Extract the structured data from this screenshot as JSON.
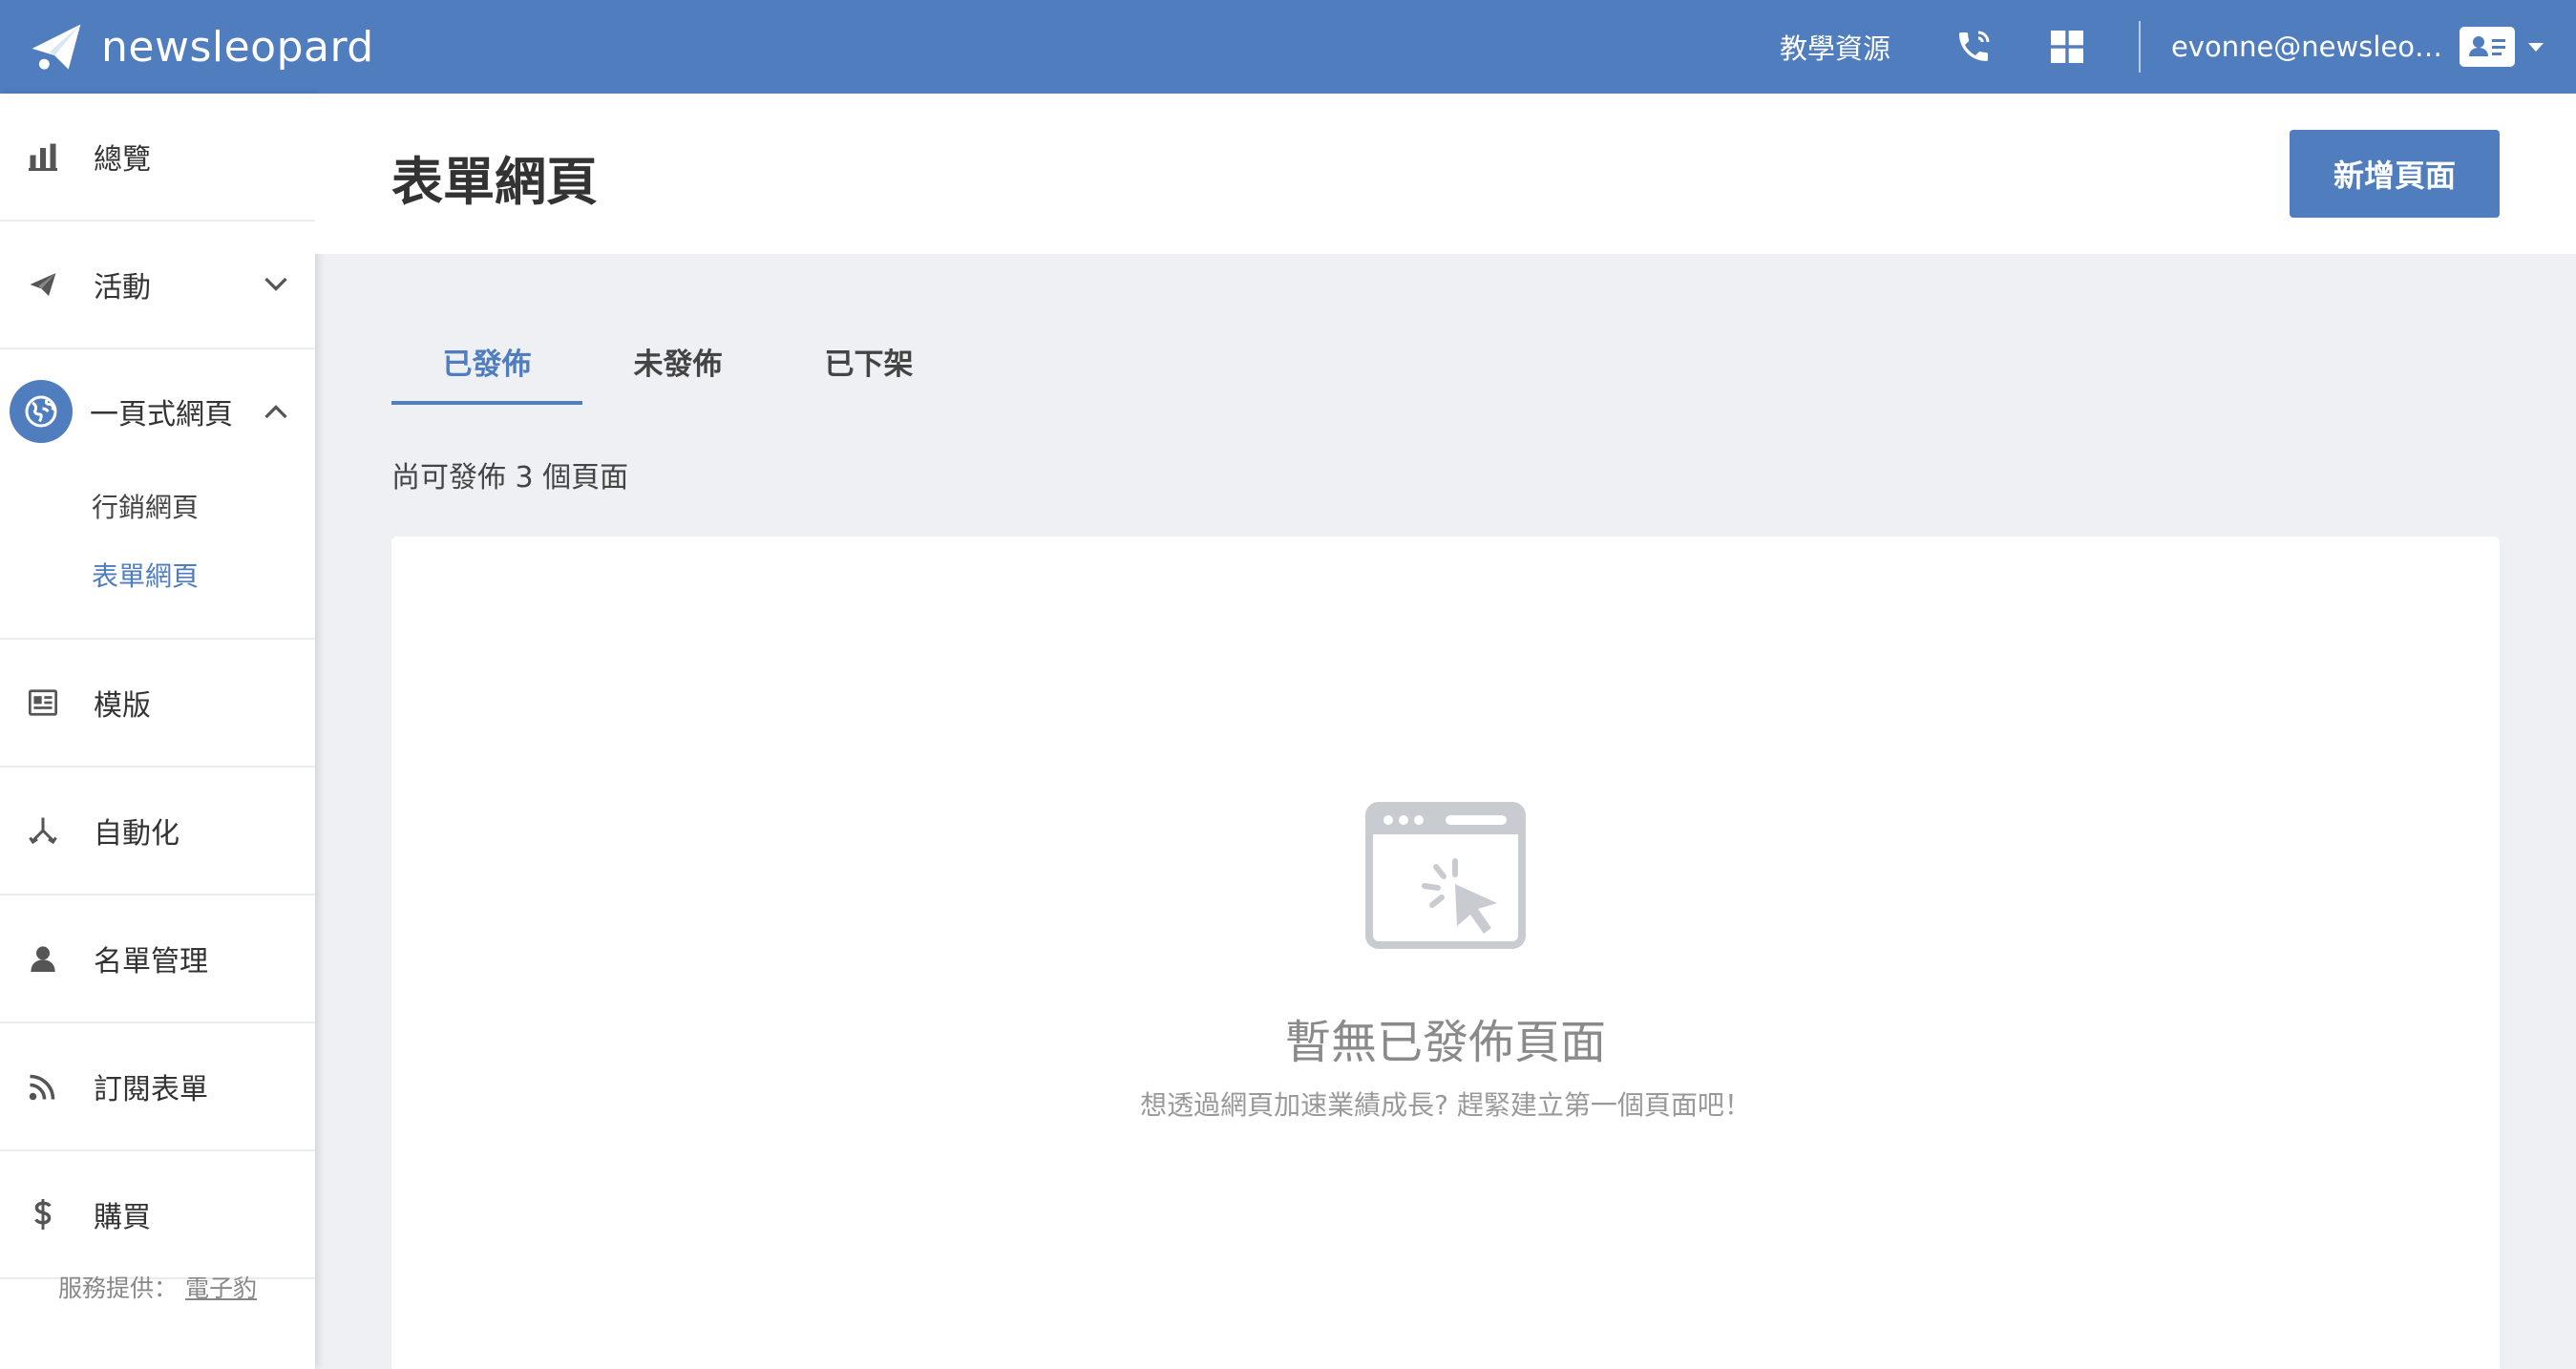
{
  "header": {
    "brand": "newsleopard",
    "resources_link": "教學資源",
    "user_email": "evonne@newsleo…",
    "icons": [
      "paper-plane-icon",
      "phone-icon",
      "apps-grid-icon",
      "contact-card-icon",
      "caret-down-icon"
    ]
  },
  "sidebar": {
    "items": [
      {
        "label": "總覽",
        "icon": "bar-chart-icon"
      },
      {
        "label": "活動",
        "icon": "paper-plane-icon"
      },
      {
        "label": "一頁式網頁",
        "icon": "globe-icon"
      },
      {
        "label": "模版",
        "icon": "template-icon"
      },
      {
        "label": "自動化",
        "icon": "automation-icon"
      },
      {
        "label": "名單管理",
        "icon": "person-icon"
      },
      {
        "label": "訂閱表單",
        "icon": "rss-icon"
      },
      {
        "label": "購買",
        "icon": "dollar-icon"
      }
    ],
    "sub_items": [
      "行銷網頁",
      "表單網頁"
    ],
    "footer_prefix": "服務提供：",
    "footer_link": "電子豹"
  },
  "page": {
    "title": "表單網頁",
    "new_button": "新增頁面",
    "tabs": [
      "已發佈",
      "未發佈",
      "已下架"
    ],
    "quota_text": "尚可發佈 3 個頁面"
  },
  "empty_state": {
    "title": "暫無已發佈頁面",
    "subtitle": "想透過網頁加速業績成長? 趕緊建立第一個頁面吧！"
  },
  "colors": {
    "primary": "#4f7dbe",
    "background": "#eef0f4"
  }
}
